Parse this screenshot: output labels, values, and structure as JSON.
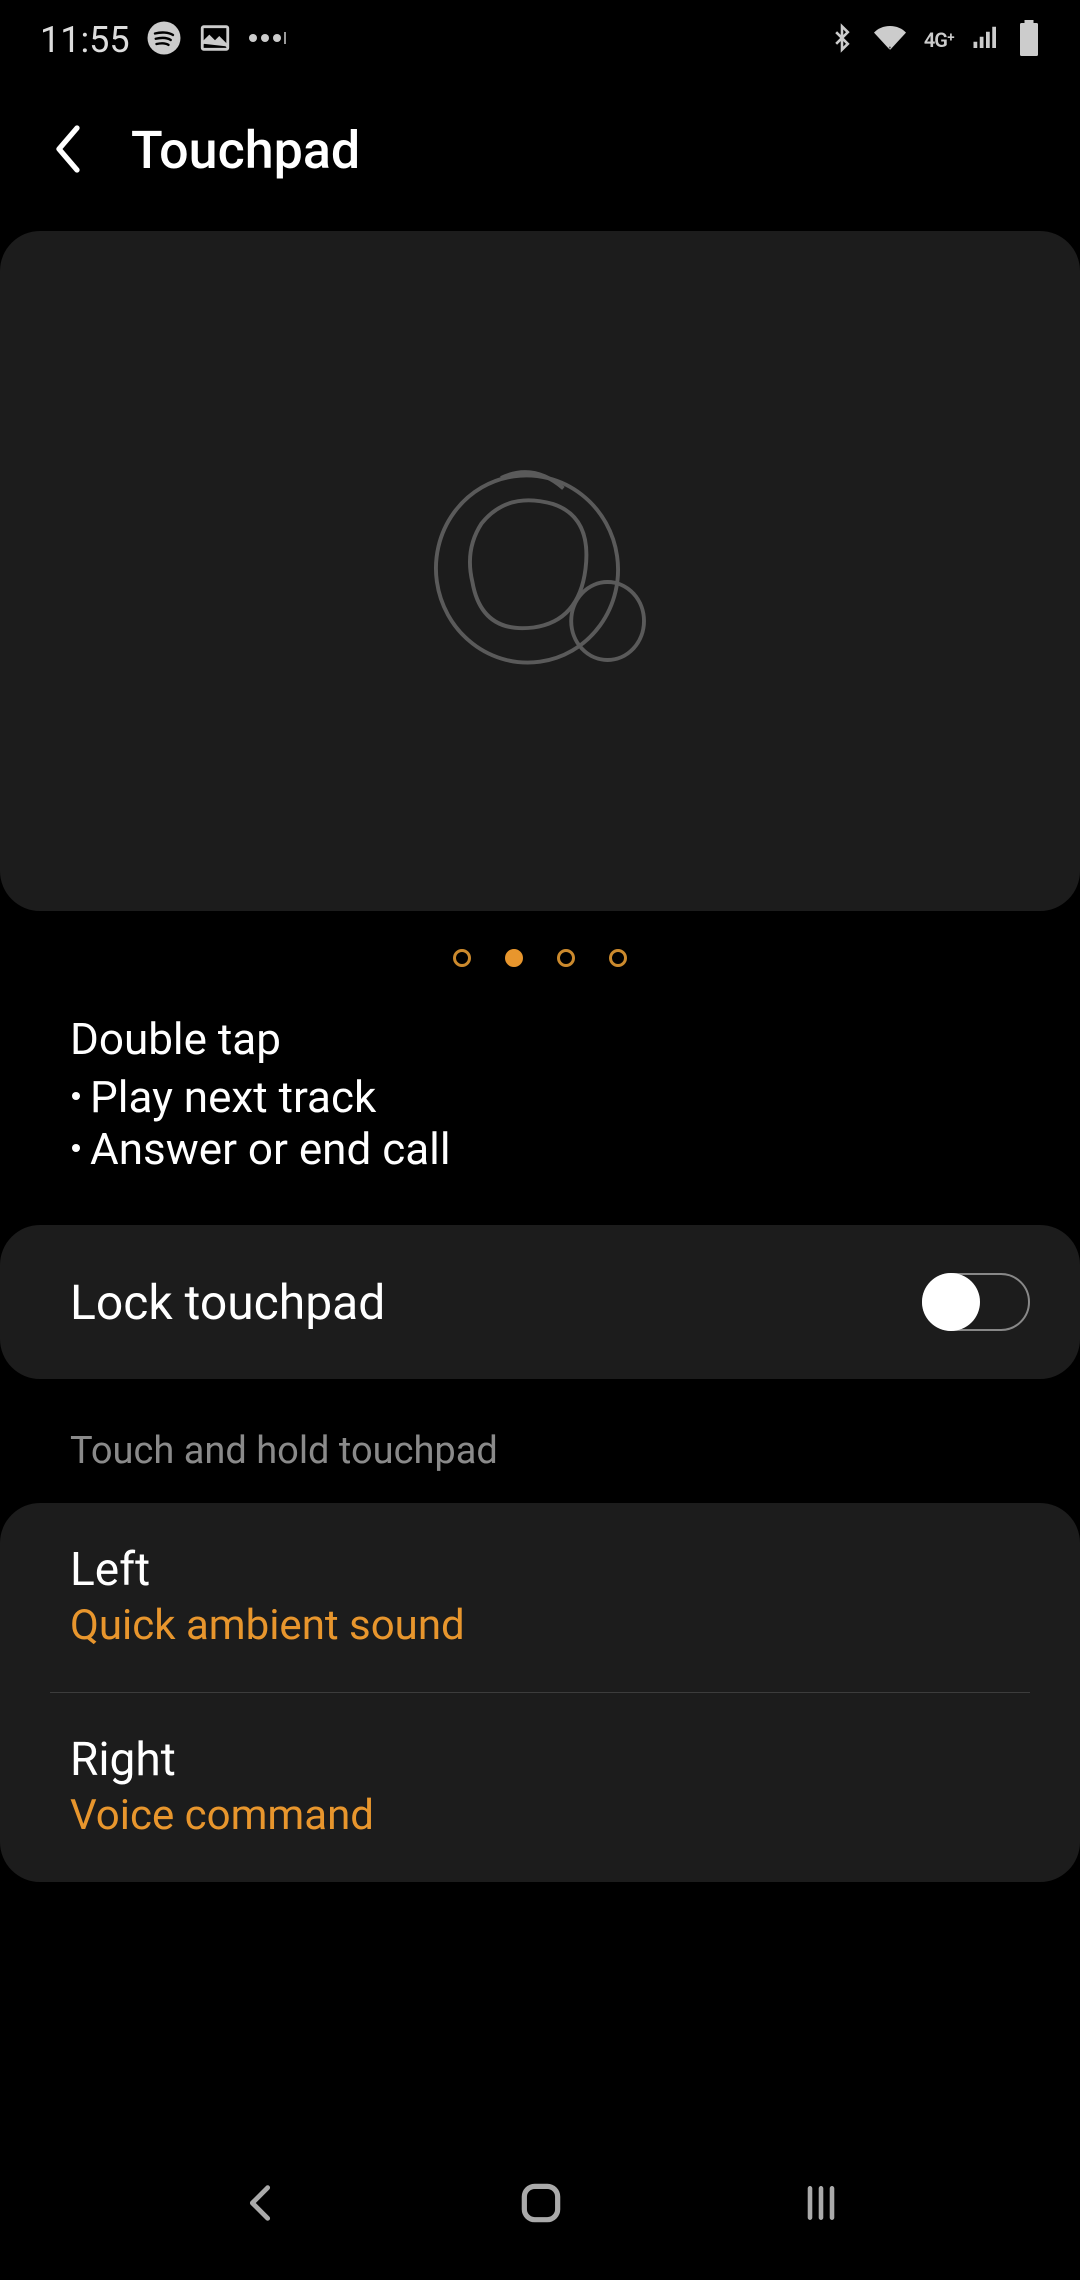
{
  "status": {
    "time": "11:55",
    "icons_left": [
      "spotify-icon",
      "image-icon",
      "more-dots-icon"
    ],
    "icons_right": [
      "bluetooth-icon",
      "wifi-icon",
      "4g-icon",
      "signal-icon",
      "battery-icon"
    ],
    "network_label": "4G"
  },
  "header": {
    "title": "Touchpad"
  },
  "carousel": {
    "active_index": 1,
    "total_dots": 4
  },
  "gesture": {
    "title": "Double tap",
    "lines": [
      "Play next track",
      "Answer or end call"
    ]
  },
  "lock_touchpad": {
    "label": "Lock touchpad",
    "enabled": false
  },
  "section": {
    "label": "Touch and hold touchpad"
  },
  "hold_actions": {
    "left": {
      "title": "Left",
      "value": "Quick ambient sound"
    },
    "right": {
      "title": "Right",
      "value": "Voice command"
    }
  }
}
